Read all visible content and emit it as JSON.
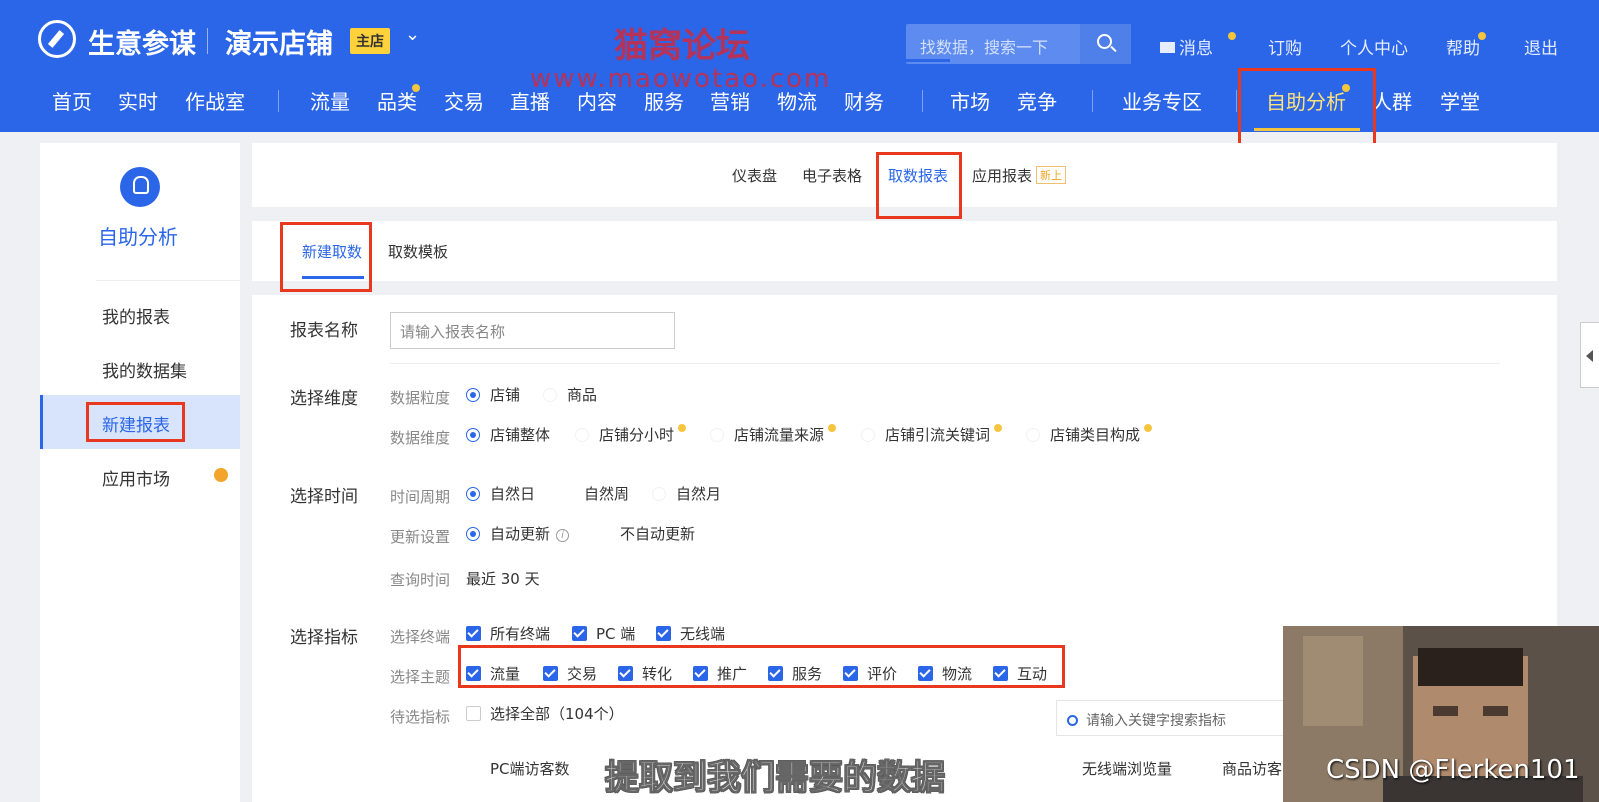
{
  "header": {
    "brand": "生意参谋",
    "shop_name": "演示店铺",
    "shop_badge": "主店",
    "watermark_cn": "猫窝论坛",
    "watermark_url": "www.maowotao.com",
    "search_placeholder": "找数据，搜索一下",
    "links": [
      "消息",
      "订购",
      "个人中心",
      "帮助",
      "退出"
    ]
  },
  "nav": {
    "items": [
      "首页",
      "实时",
      "作战室",
      "流量",
      "品类",
      "交易",
      "直播",
      "内容",
      "服务",
      "营销",
      "物流",
      "财务",
      "市场",
      "竞争",
      "业务专区",
      "自助分析",
      "人群",
      "学堂"
    ],
    "active": "自助分析"
  },
  "sidebar": {
    "title": "自助分析",
    "items": [
      "我的报表",
      "我的数据集",
      "新建报表",
      "应用市场"
    ],
    "active": "新建报表"
  },
  "tabs": {
    "items": [
      "仪表盘",
      "电子表格",
      "取数报表",
      "应用报表"
    ],
    "new_badge": "新上",
    "active": "取数报表"
  },
  "subtabs": {
    "items": [
      "新建取数",
      "取数模板"
    ],
    "active": "新建取数"
  },
  "form": {
    "report_name_label": "报表名称",
    "report_name_placeholder": "请输入报表名称",
    "dimension": {
      "label": "选择维度",
      "granularity_label": "数据粒度",
      "granularity_options": [
        "店铺",
        "商品"
      ],
      "dimension_label": "数据维度",
      "dimension_options": [
        "店铺整体",
        "店铺分小时",
        "店铺流量来源",
        "店铺引流关键词",
        "店铺类目构成"
      ]
    },
    "time": {
      "label": "选择时间",
      "period_label": "时间周期",
      "period_options": [
        "自然日",
        "自然周",
        "自然月"
      ],
      "update_label": "更新设置",
      "update_options": [
        "自动更新",
        "不自动更新"
      ],
      "query_label": "查询时间",
      "query_value": "最近 30 天"
    },
    "metrics": {
      "label": "选择指标",
      "terminal_label": "选择终端",
      "terminal_options": [
        "所有终端",
        "PC 端",
        "无线端"
      ],
      "theme_label": "选择主题",
      "theme_options": [
        "流量",
        "交易",
        "转化",
        "推广",
        "服务",
        "评价",
        "物流",
        "互动"
      ],
      "pending_label": "待选指标",
      "select_all": "选择全部（104个）",
      "keyword_placeholder": "请输入关键字搜索指标",
      "metric_items": [
        "PC端访客数",
        "无线端浏览量",
        "商品访客"
      ]
    }
  },
  "overlay": {
    "subtitle": "提取到我们需要的数据",
    "credit": "CSDN @Flerken101"
  },
  "colors": {
    "primary": "#2b66e8",
    "highlight_box": "#e8391f",
    "notice_dot": "#f6c53f"
  }
}
